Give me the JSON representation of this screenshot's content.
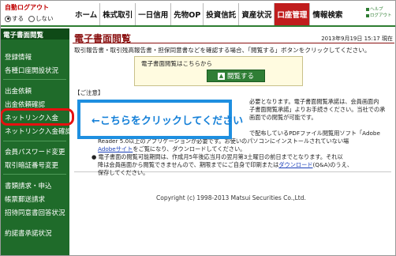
{
  "auto_logout": {
    "title": "自動ログアウト",
    "options": [
      "する",
      "しない"
    ],
    "selected": "する"
  },
  "nav": {
    "items": [
      "ホーム",
      "株式取引",
      "一日信用",
      "先物OP",
      "投資信託",
      "資産状況",
      "口座管理",
      "情報検索"
    ],
    "active": "口座管理"
  },
  "help": {
    "help_label": "ヘルプ",
    "logout_label": "ログアウト"
  },
  "sidebar": {
    "title": "電子書面閲覧",
    "items": [
      "登録情報",
      "各種口座開設状況",
      "出金依頼",
      "出金依頼確認",
      "ネットリンク入金",
      "ネットリンク入金確認",
      "会員パスワード変更",
      "取引暗証番号変更",
      "書類請求・申込",
      "帳票郵送請求",
      "招待同意書回答状況",
      "約諾書承諾状況"
    ]
  },
  "main": {
    "title": "電子書面閲覧",
    "date": "2013年9月19日 15:17 現在",
    "description": "取引報告書・取引残高報告書・担保同意書などを確認する場合、「閲覧する」ボタンをクリックしてください。",
    "view_box_label": "電子書面閲覧はこちらから",
    "view_button": "閲覧する",
    "notes_title": "【ご注意】",
    "notes_lines": [
      "必要となります。電子書面閲覧承諾は、会員画面内",
      "子書面閲覧承諾」よりお手続きください。当社での承",
      "画面での閲覧が可能です。",
      "で配布しているPDFファイル閲覧用ソフト「Adobe",
      "Reader 5.0以上のアプリケーションが必要です。お使いのパソコンにインストールされていない場",
      "合、Adobeサイトをご覧になり、ダウンロードしてください。",
      "● 電子書面の閲覧可能期間は、作成月5年後応当月の翌月第3土曜日の前日までとなります。それ以",
      "降は会員画面から閲覧できませんので、期限までにご自身で印刷またはダウンロード(Q&A)のうえ、",
      "保存してください。"
    ],
    "copyright": "Copyright (c) 1998-2013 Matsui Securities Co.,Ltd."
  },
  "callout": {
    "text": "←こちらをクリックしてください"
  }
}
